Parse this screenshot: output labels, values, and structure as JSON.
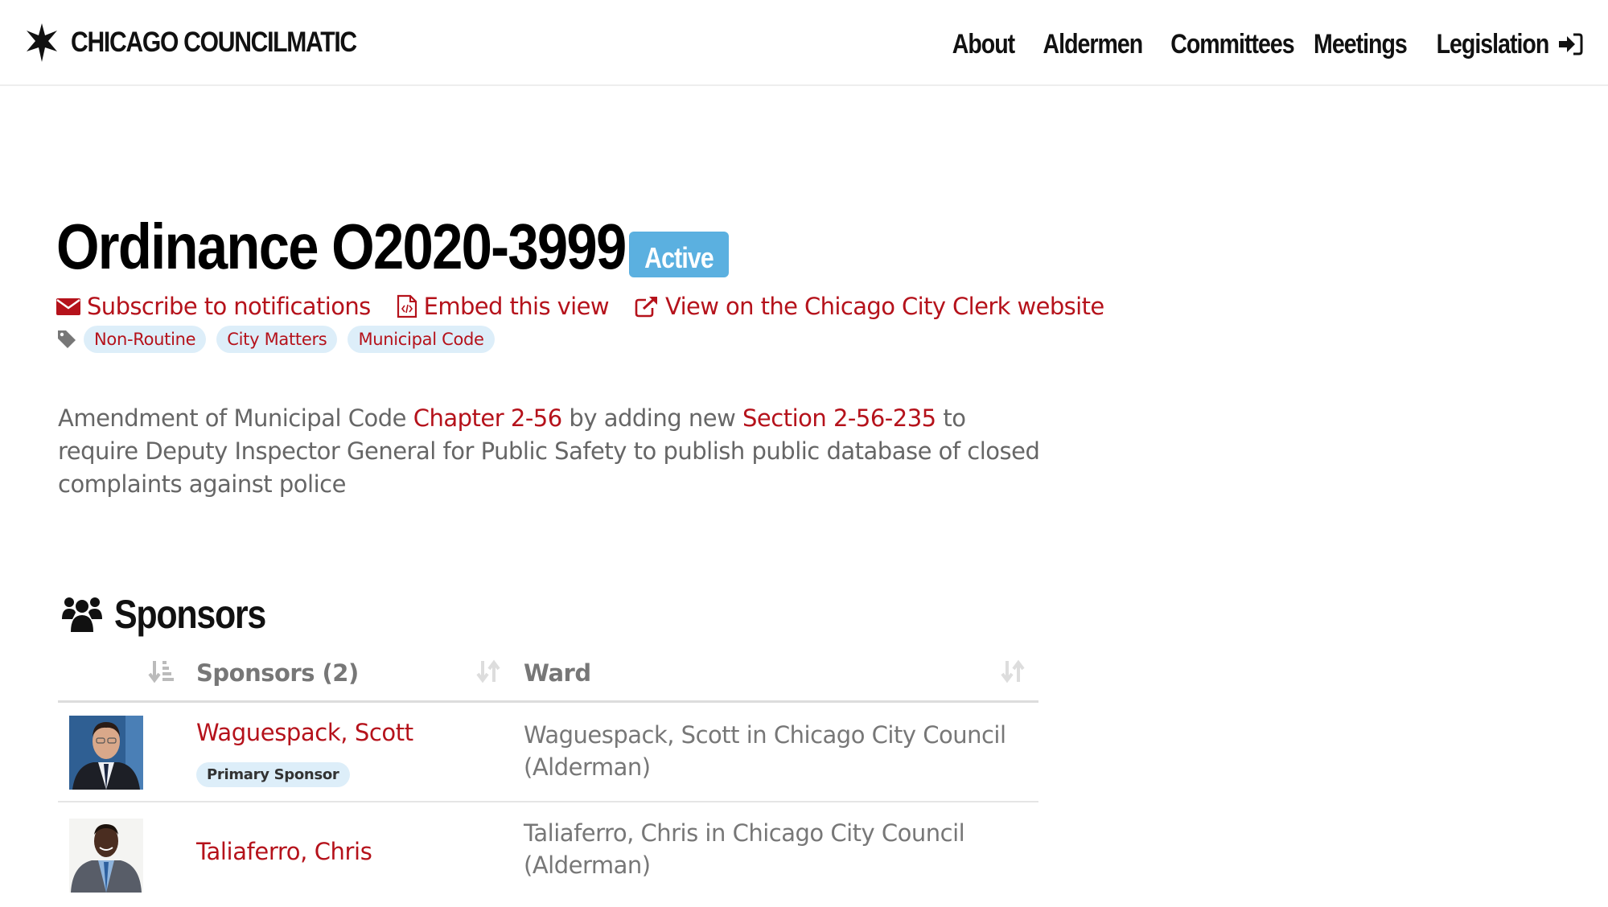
{
  "header": {
    "brand": "CHICAGO COUNCILMATIC",
    "brand_icon": "six-pointed-star-icon",
    "nav": [
      {
        "label": "About"
      },
      {
        "label": "Aldermen"
      },
      {
        "label": "Committees"
      },
      {
        "label": "Meetings"
      },
      {
        "label": "Legislation"
      }
    ],
    "signin_icon": "sign-in-icon"
  },
  "legislation": {
    "title": "Ordinance O2020-3999",
    "status": "Active",
    "status_color": "#5bb0e0",
    "actions": [
      {
        "label": "Subscribe to notifications",
        "icon": "envelope-icon"
      },
      {
        "label": "Embed this view",
        "icon": "file-code-icon"
      },
      {
        "label": "View on the Chicago City Clerk website",
        "icon": "external-link-icon"
      }
    ],
    "tags": [
      "Non-Routine",
      "City Matters",
      "Municipal Code"
    ],
    "description": {
      "part1": "Amendment of Municipal Code ",
      "link1": "Chapter 2-56",
      "part2": " by adding new ",
      "link2": "Section 2-56-235",
      "part3": " to require Deputy Inspector General for Public Safety to publish public database of closed complaints against police"
    }
  },
  "sponsors": {
    "heading": "Sponsors",
    "columns": [
      "Sponsors (2)",
      "Ward"
    ],
    "rows": [
      {
        "name": "Waguespack, Scott",
        "badge": "Primary Sponsor",
        "ward": "Waguespack, Scott in Chicago City Council (Alderman)"
      },
      {
        "name": "Taliaferro, Chris",
        "badge": null,
        "ward": "Taliaferro, Chris in Chicago City Council (Alderman)"
      }
    ]
  },
  "colors": {
    "accent": "#b5121b",
    "tag_bg": "#ddeef9",
    "muted_text": "#666666"
  }
}
